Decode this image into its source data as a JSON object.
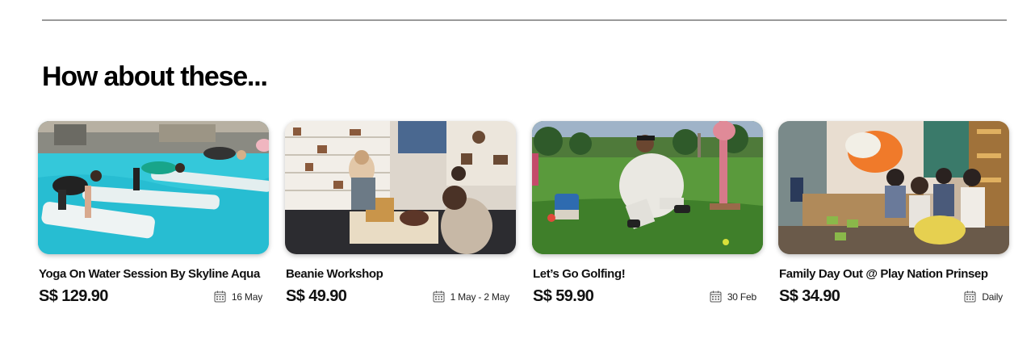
{
  "section": {
    "heading": "How about these..."
  },
  "cards": [
    {
      "title": "Yoga On Water Session By Skyline Aqua",
      "price": "S$ 129.90",
      "date": "16 May",
      "image": "yoga-on-water-photo"
    },
    {
      "title": "Beanie Workshop",
      "price": "S$ 49.90",
      "date": "1 May - 2 May",
      "image": "beanie-workshop-photo"
    },
    {
      "title": "Let’s Go Golfing!",
      "price": "S$ 59.90",
      "date": "30 Feb",
      "image": "golf-lawn-photo"
    },
    {
      "title": "Family Day Out @ Play Nation Prinsep",
      "price": "S$ 34.90",
      "date": "Daily",
      "image": "play-nation-arcade-photo"
    }
  ],
  "icons": {
    "date": "calendar-icon"
  },
  "colors": {
    "divider": "#9a9a9a",
    "text": "#111111",
    "pool": "#2fc4d6",
    "grass": "#4f8f35"
  }
}
